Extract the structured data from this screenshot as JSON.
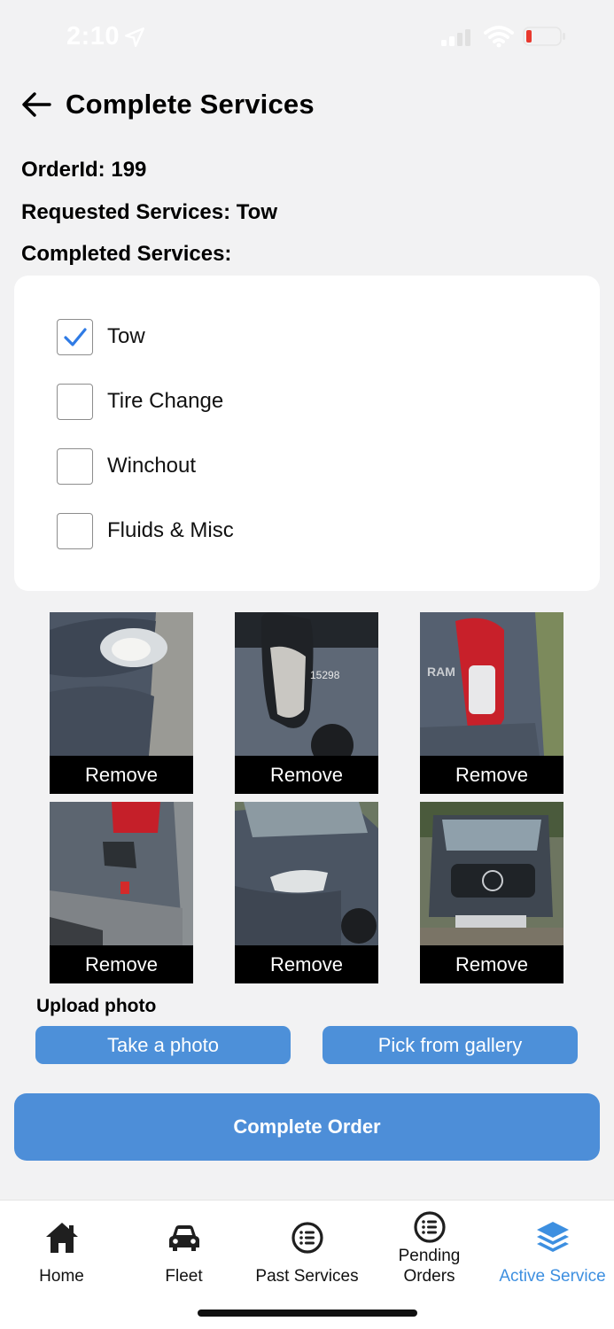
{
  "status_bar": {
    "time": "2:10",
    "icons": [
      "location-arrow-icon",
      "signal-icon",
      "wifi-icon",
      "battery-icon"
    ],
    "battery_color": "#e8392e"
  },
  "header": {
    "title": "Complete Services",
    "back_icon": "arrow-left-icon"
  },
  "order": {
    "order_id_line": "OrderId: 199",
    "requested_line": "Requested Services: Tow",
    "completed_heading": "Completed Services:"
  },
  "services": [
    {
      "label": "Tow",
      "checked": true
    },
    {
      "label": "Tire Change",
      "checked": false
    },
    {
      "label": "Winchout",
      "checked": false
    },
    {
      "label": "Fluids & Misc",
      "checked": false
    }
  ],
  "photos": [
    {
      "remove_label": "Remove"
    },
    {
      "remove_label": "Remove"
    },
    {
      "remove_label": "Remove"
    },
    {
      "remove_label": "Remove"
    },
    {
      "remove_label": "Remove"
    },
    {
      "remove_label": "Remove"
    }
  ],
  "upload": {
    "label": "Upload photo",
    "take_photo": "Take a photo",
    "pick_gallery": "Pick from gallery"
  },
  "complete_button": "Complete Order",
  "tabs": [
    {
      "label": "Home",
      "icon": "home-icon",
      "active": false
    },
    {
      "label": "Fleet",
      "icon": "car-icon",
      "active": false
    },
    {
      "label": "Past Services",
      "icon": "list-icon",
      "active": false
    },
    {
      "label_line1": "Pending",
      "label_line2": "Orders",
      "icon": "list-icon",
      "active": false
    },
    {
      "label": "Active Service",
      "icon": "layers-icon",
      "active": true
    }
  ],
  "colors": {
    "accent": "#4d8ed8",
    "active_tab": "#3d8fe0",
    "check": "#2f7be5",
    "background": "#f2f2f3"
  }
}
